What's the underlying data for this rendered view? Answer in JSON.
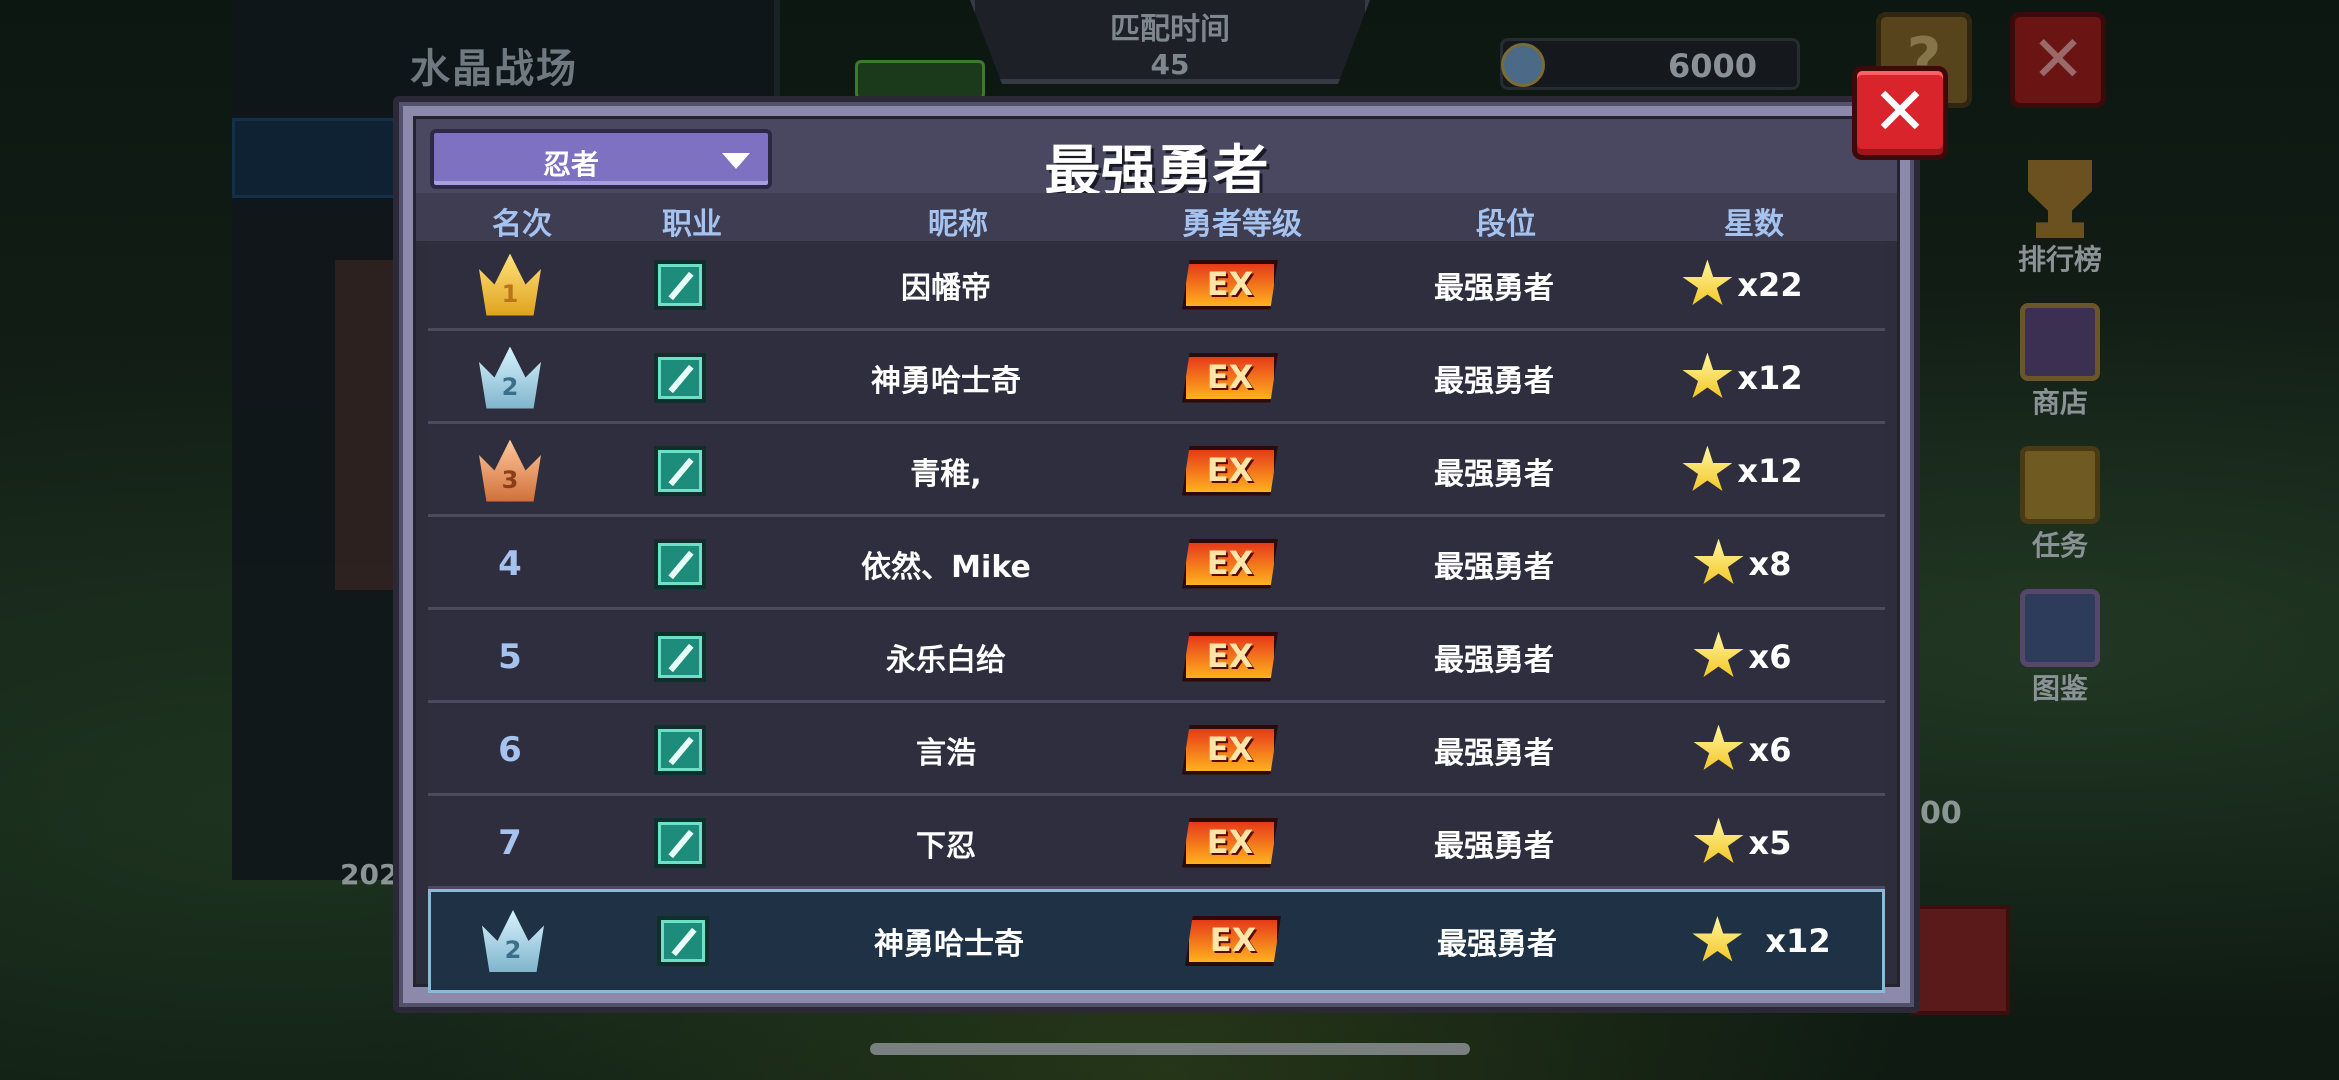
{
  "background": {
    "mode_title": "水晶战场",
    "match_time_label": "匹配时间",
    "match_time_value": "45",
    "coin_value": "6000",
    "help_label": "?",
    "year_fragment": "202",
    "right_fragment": "00",
    "side_menu": [
      {
        "label": "排行榜",
        "icon": "trophy-icon"
      },
      {
        "label": "商店",
        "icon": "shop-icon"
      },
      {
        "label": "任务",
        "icon": "task-scroll-icon"
      },
      {
        "label": "图鉴",
        "icon": "codex-icon"
      }
    ]
  },
  "dialog": {
    "title": "最强勇者",
    "class_filter": "忍者",
    "close_label": "✕",
    "columns": {
      "rank": "名次",
      "class": "职业",
      "nickname": "昵称",
      "hero_level": "勇者等级",
      "tier": "段位",
      "stars": "星数"
    },
    "level_badge_text": "EX",
    "rows": [
      {
        "rank": "1",
        "medal": "gold",
        "nickname": "因幡帝",
        "tier": "最强勇者",
        "stars": "x22"
      },
      {
        "rank": "2",
        "medal": "silver",
        "nickname": "神勇哈士奇",
        "tier": "最强勇者",
        "stars": "x12"
      },
      {
        "rank": "3",
        "medal": "bronze",
        "nickname": "青稚,",
        "tier": "最强勇者",
        "stars": "x12"
      },
      {
        "rank": "4",
        "medal": "",
        "nickname": "依然、Mike",
        "tier": "最强勇者",
        "stars": "x8"
      },
      {
        "rank": "5",
        "medal": "",
        "nickname": "永乐白给",
        "tier": "最强勇者",
        "stars": "x6"
      },
      {
        "rank": "6",
        "medal": "",
        "nickname": "言浩",
        "tier": "最强勇者",
        "stars": "x6"
      },
      {
        "rank": "7",
        "medal": "",
        "nickname": "下忍",
        "tier": "最强勇者",
        "stars": "x5"
      }
    ],
    "self_row": {
      "rank": "2",
      "medal": "silver",
      "nickname": "神勇哈士奇",
      "tier": "最强勇者",
      "stars": "x12"
    }
  },
  "colors": {
    "accent_purple": "#7e71c2",
    "close_red": "#d8242a",
    "header_blue_text": "#a6c2ef",
    "self_row_bg": "#1e3145"
  }
}
